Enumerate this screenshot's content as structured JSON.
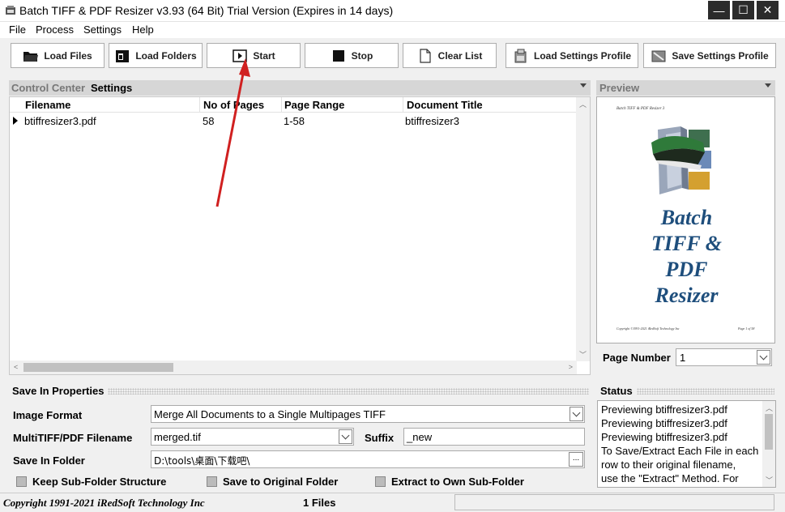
{
  "window": {
    "title": "Batch TIFF & PDF Resizer v3.93 (64 Bit)  Trial Version (Expires in 14 days)",
    "minimize": "—",
    "maximize": "☐",
    "close": "✕"
  },
  "menu": [
    "File",
    "Process",
    "Settings",
    "Help"
  ],
  "toolbar": {
    "load_files": "Load Files",
    "load_folders": "Load Folders",
    "start": "Start",
    "stop": "Stop",
    "clear_list": "Clear List",
    "load_profile": "Load Settings Profile",
    "save_profile": "Save Settings Profile"
  },
  "tabs": {
    "control_center": "Control Center",
    "settings": "Settings",
    "preview": "Preview"
  },
  "file_grid": {
    "columns": [
      "Filename",
      "No of Pages",
      "Page Range",
      "Document Title"
    ],
    "rows": [
      {
        "filename": "btiffresizer3.pdf",
        "pages": "58",
        "range": "1-58",
        "title": "btiffresizer3"
      }
    ]
  },
  "preview": {
    "doc_header": "Batch TIFF & PDF Resizer 3",
    "doc_title_lines": [
      "Batch",
      "TIFF &",
      "PDF",
      "Resizer"
    ],
    "doc_footer_left": "Copyright ©1991-2021 iRedSoft Technology Inc",
    "doc_footer_right": "Page 1 of 58",
    "page_number_label": "Page Number",
    "page_number_value": "1"
  },
  "save_props": {
    "section": "Save In Properties",
    "image_format_label": "Image Format",
    "image_format_value": "Merge All Documents to a Single Multipages TIFF",
    "filename_label": "MultiTIFF/PDF Filename",
    "filename_value": "merged.tif",
    "suffix_label": "Suffix",
    "suffix_value": "_new",
    "folder_label": "Save In Folder",
    "folder_value": "D:\\tools\\桌面\\下载吧\\",
    "browse": "...",
    "keep_subfolder": "Keep Sub-Folder Structure",
    "save_original": "Save to Original Folder",
    "extract_own": "Extract to Own Sub-Folder"
  },
  "status": {
    "section": "Status",
    "lines": [
      "Previewing btiffresizer3.pdf",
      "Previewing btiffresizer3.pdf",
      "Previewing btiffresizer3.pdf",
      "To Save/Extract Each File in each",
      "row to their original filename,",
      "use the \"Extract\" Method. For"
    ]
  },
  "statusbar": {
    "copyright": "Copyright 1991-2021 iRedSoft Technology Inc",
    "files": "1 Files"
  },
  "colors": {
    "annotation_arrow": "#d02020",
    "preview_title": "#1e4e7c"
  }
}
